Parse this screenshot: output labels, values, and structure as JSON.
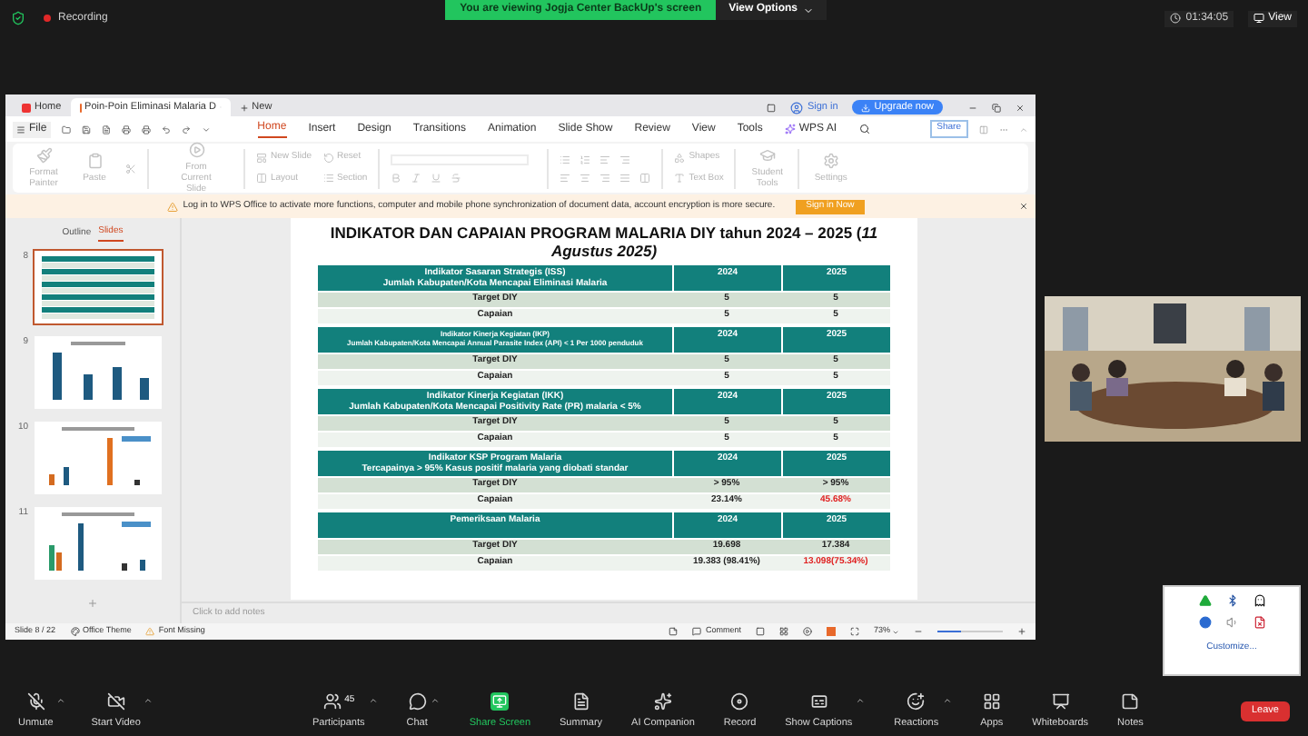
{
  "meeting": {
    "recording": "Recording",
    "banner": "You are viewing Jogja Center BackUp's screen",
    "view_options": "View Options",
    "timer": "01:34:05",
    "view": "View"
  },
  "wps": {
    "tabs": [
      {
        "label": "Home",
        "selected": false,
        "kind": "home"
      },
      {
        "label": "Poin-Poin Eliminasi Malaria D",
        "selected": true,
        "kind": "doc"
      },
      {
        "label": "New",
        "selected": false,
        "kind": "new"
      }
    ],
    "sign_in": "Sign in",
    "upgrade": "Upgrade now",
    "file": "File",
    "menu": [
      {
        "label": "Home",
        "selected": true
      },
      {
        "label": "Insert",
        "selected": false
      },
      {
        "label": "Design",
        "selected": false
      },
      {
        "label": "Transitions",
        "selected": false
      },
      {
        "label": "Animation",
        "selected": false
      },
      {
        "label": "Slide Show",
        "selected": false
      },
      {
        "label": "Review",
        "selected": false
      },
      {
        "label": "View",
        "selected": false
      },
      {
        "label": "Tools",
        "selected": false
      }
    ],
    "ai": "WPS AI",
    "share": "Share",
    "ribbon": [
      {
        "label": "Format Painter"
      },
      {
        "label": "Paste"
      },
      {
        "label": "From Current Slide"
      },
      {
        "label": "New Slide"
      },
      {
        "label": "Layout"
      },
      {
        "label": "Reset"
      },
      {
        "label": "Section"
      },
      {
        "label": "Shapes"
      },
      {
        "label": "Text Box"
      },
      {
        "label": "Student Tools"
      },
      {
        "label": "Settings"
      }
    ],
    "notice": {
      "text": "Log in to WPS Office to activate more functions, computer and mobile phone synchronization of document data, account encryption is more secure.",
      "button": "Sign in Now"
    },
    "panel_tabs": [
      {
        "label": "Outline",
        "selected": false
      },
      {
        "label": "Slides",
        "selected": true
      }
    ],
    "thumbnails": [
      {
        "number": "8",
        "selected": true,
        "kind": "table"
      },
      {
        "number": "9",
        "selected": false,
        "kind": "bars"
      },
      {
        "number": "10",
        "selected": false,
        "kind": "mixed"
      },
      {
        "number": "11",
        "selected": false,
        "kind": "mixed"
      }
    ],
    "slide": {
      "title": "INDIKATOR DAN CAPAIAN PROGRAM MALARIA DIY tahun 2024 – 2025 (*11 Agustus 2025)*",
      "sections": [
        {
          "header": [
            "Indikator Sasaran Strategis (ISS)",
            "Jumlah Kabupaten/Kota Mencapai Eliminasi Malaria"
          ],
          "col_2024": "2024",
          "col_2025": "2025",
          "compact": false,
          "rows": [
            {
              "label": "Target DIY",
              "v2024": "5",
              "v2025": "5",
              "alert": false
            },
            {
              "label": "Capaian",
              "v2024": "5",
              "v2025": "5",
              "alert": false
            }
          ]
        },
        {
          "header": [
            "Indikator Kinerja Kegiatan (IKP)",
            "Jumlah Kabupaten/Kota Mencapai Annual Parasite Index (API) < 1 Per 1000 penduduk"
          ],
          "col_2024": "2024",
          "col_2025": "2025",
          "compact": true,
          "rows": [
            {
              "label": "Target DIY",
              "v2024": "5",
              "v2025": "5",
              "alert": false
            },
            {
              "label": "Capaian",
              "v2024": "5",
              "v2025": "5",
              "alert": false
            }
          ]
        },
        {
          "header": [
            "Indikator  Kinerja Kegiatan (IKK)",
            "Jumlah Kabupaten/Kota Mencapai Positivity Rate (PR) malaria < 5%"
          ],
          "col_2024": "2024",
          "col_2025": "2025",
          "compact": false,
          "rows": [
            {
              "label": "Target DIY",
              "v2024": "5",
              "v2025": "5",
              "alert": false
            },
            {
              "label": "Capaian",
              "v2024": "5",
              "v2025": "5",
              "alert": false
            }
          ]
        },
        {
          "header": [
            "Indikator KSP Program Malaria",
            "Tercapainya > 95% Kasus positif malaria yang diobati standar"
          ],
          "col_2024": "2024",
          "col_2025": "2025",
          "compact": false,
          "rows": [
            {
              "label": "Target DIY",
              "v2024": "> 95%",
              "v2025": "> 95%",
              "alert": false
            },
            {
              "label": "Capaian",
              "v2024": "23.14%",
              "v2025": "45.68%",
              "alert": true
            }
          ]
        },
        {
          "header": [
            "Pemeriksaan Malaria"
          ],
          "col_2024": "2024",
          "col_2025": "2025",
          "compact": false,
          "rows": [
            {
              "label": "Target DIY",
              "v2024": "19.698",
              "v2025": "17.384",
              "alert": false
            },
            {
              "label": "Capaian",
              "v2024": "19.383 (98.41%)",
              "v2025": "13.098(75.34%)",
              "alert": true
            }
          ]
        }
      ]
    },
    "notes_placeholder": "Click to add notes",
    "status": {
      "slide": "Slide 8 / 22",
      "theme": "Office Theme",
      "font": "Font Missing",
      "comment": "Comment",
      "zoom": "73%",
      "zoom_slider": {
        "level": 0.35
      }
    }
  },
  "tray": {
    "customize": "Customize..."
  },
  "toolbar": [
    {
      "label": "Unmute",
      "kind": "mic",
      "caret": true
    },
    {
      "label": "Start Video",
      "kind": "video",
      "caret": true
    },
    {
      "label": "Participants",
      "kind": "participants",
      "count": "45",
      "caret": true
    },
    {
      "label": "Chat",
      "kind": "chat",
      "caret": true
    },
    {
      "label": "Share Screen",
      "kind": "share",
      "caret": false
    },
    {
      "label": "Summary",
      "kind": "summary",
      "caret": false
    },
    {
      "label": "AI Companion",
      "kind": "ai",
      "caret": false
    },
    {
      "label": "Record",
      "kind": "record",
      "caret": false
    },
    {
      "label": "Show Captions",
      "kind": "captions",
      "caret": true
    },
    {
      "label": "Reactions",
      "kind": "reactions",
      "caret": true
    },
    {
      "label": "Apps",
      "kind": "apps",
      "caret": false
    },
    {
      "label": "Whiteboards",
      "kind": "whiteboards",
      "caret": false
    },
    {
      "label": "Notes",
      "kind": "notes",
      "caret": false
    },
    {
      "label": "Leave",
      "kind": "leave"
    }
  ]
}
